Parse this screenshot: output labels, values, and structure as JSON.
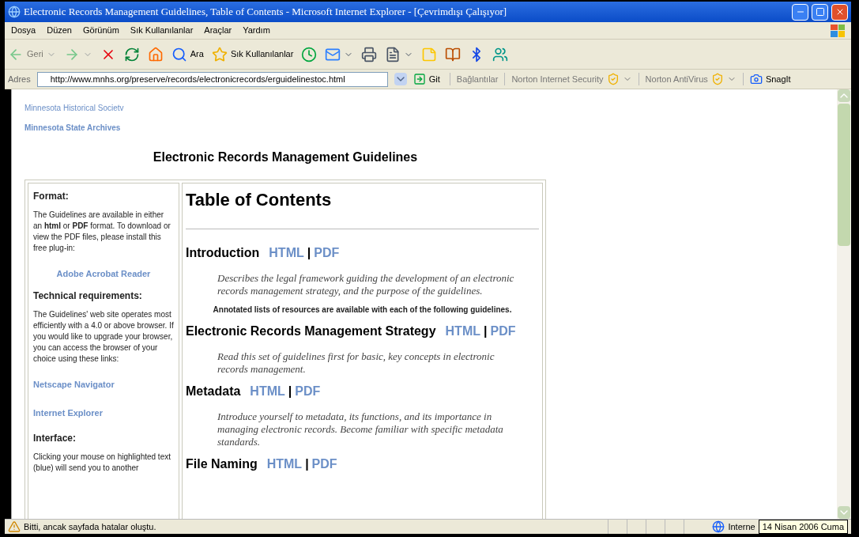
{
  "window": {
    "title": "Electronic Records Management Guidelines, Table of Contents - Microsoft Internet Explorer - [Çevrimdışı Çalışıyor]"
  },
  "menu": [
    "Dosya",
    "Düzen",
    "Görünüm",
    "Sık Kullanılanlar",
    "Araçlar",
    "Yardım"
  ],
  "toolbar": [
    {
      "label": "Geri",
      "disabled": true,
      "dropdown": true
    },
    {
      "disabled": true,
      "dropdown": true
    },
    {
      "disabled": false,
      "dropdown": false
    },
    {
      "disabled": false,
      "dropdown": false
    },
    {
      "disabled": false,
      "dropdown": false
    },
    {
      "label": "Ara",
      "disabled": false,
      "dropdown": false
    },
    {
      "label": "Sık Kullanılanlar",
      "disabled": false,
      "dropdown": false
    },
    {
      "disabled": false,
      "dropdown": false
    },
    {
      "disabled": false,
      "dropdown": true
    },
    {
      "disabled": false,
      "dropdown": false
    },
    {
      "disabled": false,
      "dropdown": true
    },
    {
      "disabled": false,
      "dropdown": false
    },
    {
      "disabled": false,
      "dropdown": false
    },
    {
      "disabled": false,
      "dropdown": false
    },
    {
      "disabled": false,
      "dropdown": false
    }
  ],
  "address_bar": {
    "label": "Adres",
    "value": "http://www.mnhs.org/preserve/records/electronicrecords/erguidelinestoc.html",
    "go": "Git",
    "links": "Bağlantılar",
    "plugins": [
      "Norton Internet Security",
      "Norton AntiVirus",
      "SnagIt"
    ]
  },
  "page": {
    "site_links": [
      {
        "text": "Minnesota Historical Societv",
        "bold": false
      },
      {
        "text": "Minnesota State Archives",
        "bold": true
      }
    ],
    "heading": "Electronic Records Management Guidelines",
    "sidebar": [
      {
        "kind": "heading",
        "text": "Format:"
      },
      {
        "kind": "text",
        "text": "The Guidelines are available in either an **html** or **PDF** format. To download or view the PDF files, please install this free plug-in:"
      },
      {
        "kind": "featured-link",
        "text": "Adobe Acrobat Reader"
      },
      {
        "kind": "heading",
        "text": "Technical requirements:"
      },
      {
        "kind": "text",
        "text": "The Guidelines' web site operates most efficiently with a 4.0 or above browser. If you would like to upgrade your browser, you can access the browser of your choice using these links:"
      },
      {
        "kind": "link",
        "text": "Netscape Navigator"
      },
      {
        "kind": "link",
        "text": "Internet Explorer"
      },
      {
        "kind": "heading",
        "text": "Interface:"
      },
      {
        "kind": "text",
        "text": "Clicking your mouse on highlighted text (blue) will send you to another"
      }
    ],
    "toc_title": "Table of Contents",
    "toc": [
      {
        "kind": "section",
        "title": "Introduction",
        "html": "HTML",
        "separator": "|",
        "pdf": "PDF",
        "description": "Describes the legal framework guiding the development of an electronic records management strategy, and the purpose of the guidelines."
      },
      {
        "kind": "note",
        "text": "Annotated lists of resources are available with each of the following guidelines."
      },
      {
        "kind": "section",
        "title": "Electronic Records Management Strategy",
        "html": "HTML",
        "separator": "|",
        "pdf": "PDF",
        "description": "Read this set of guidelines first for basic, key concepts in electronic records management."
      },
      {
        "kind": "section",
        "title": "Metadata",
        "html": "HTML",
        "separator": "|",
        "pdf": "PDF",
        "description": "Introduce yourself to metadata, its functions, and its importance in managing electronic records. Become familiar with specific metadata standards."
      },
      {
        "kind": "section",
        "title": "File Naming",
        "html": "HTML",
        "separator": "|",
        "pdf": "PDF"
      }
    ]
  },
  "status_bar": {
    "message": "Bitti, ancak sayfada hatalar oluştu.",
    "zone": "Interne",
    "tooltip": "14 Nisan 2006 Cuma"
  }
}
